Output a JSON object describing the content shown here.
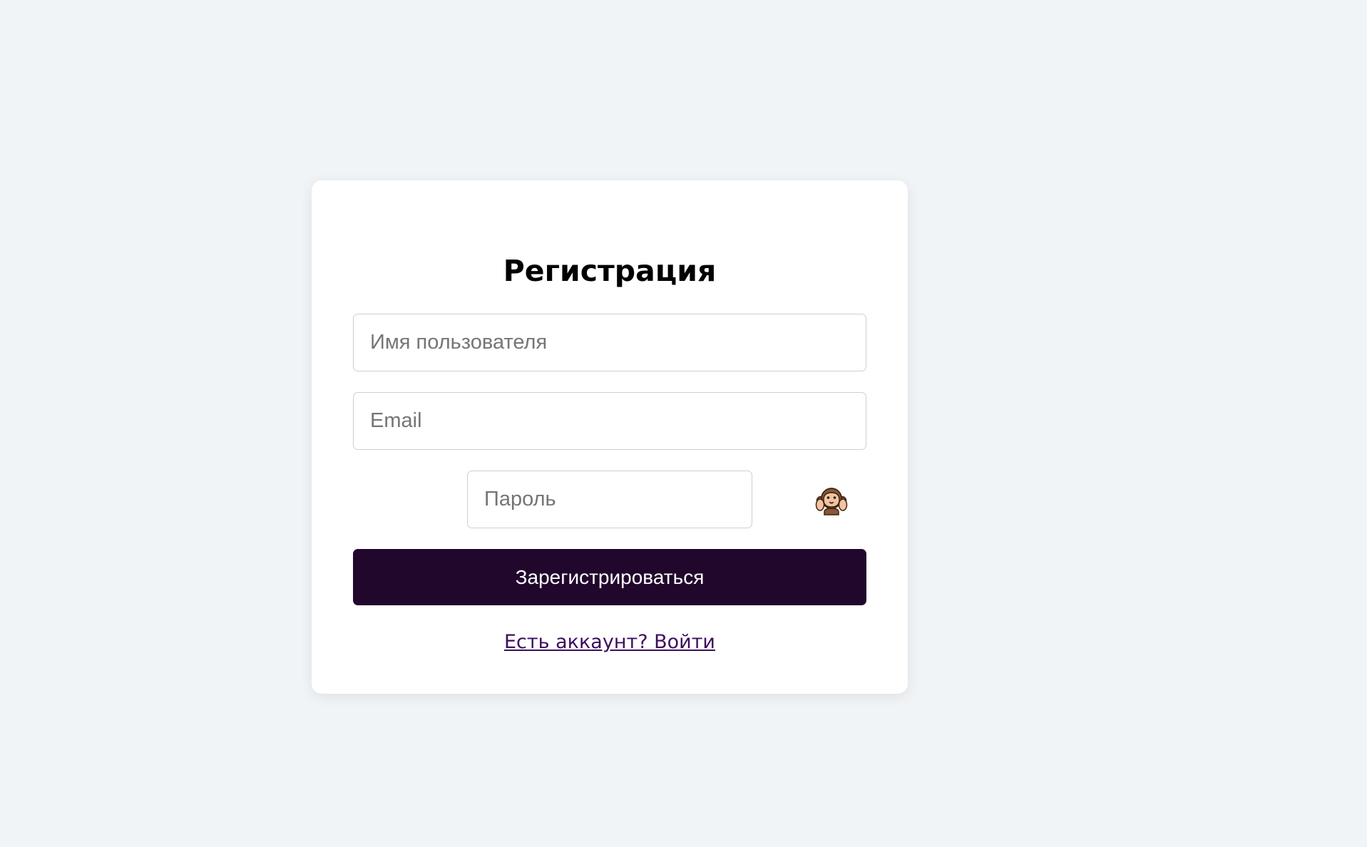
{
  "form": {
    "title": "Регистрация",
    "username_placeholder": "Имя пользователя",
    "email_placeholder": "Email",
    "password_placeholder": "Пароль",
    "password_toggle_icon": "hear-no-evil-monkey-icon",
    "submit_label": "Зарегистрироваться",
    "login_link_label": "Есть аккаунт? Войти"
  },
  "colors": {
    "page_background": "#f0f4f7",
    "card_background": "#ffffff",
    "primary_button": "#22072d",
    "link": "#3d0e5e"
  }
}
